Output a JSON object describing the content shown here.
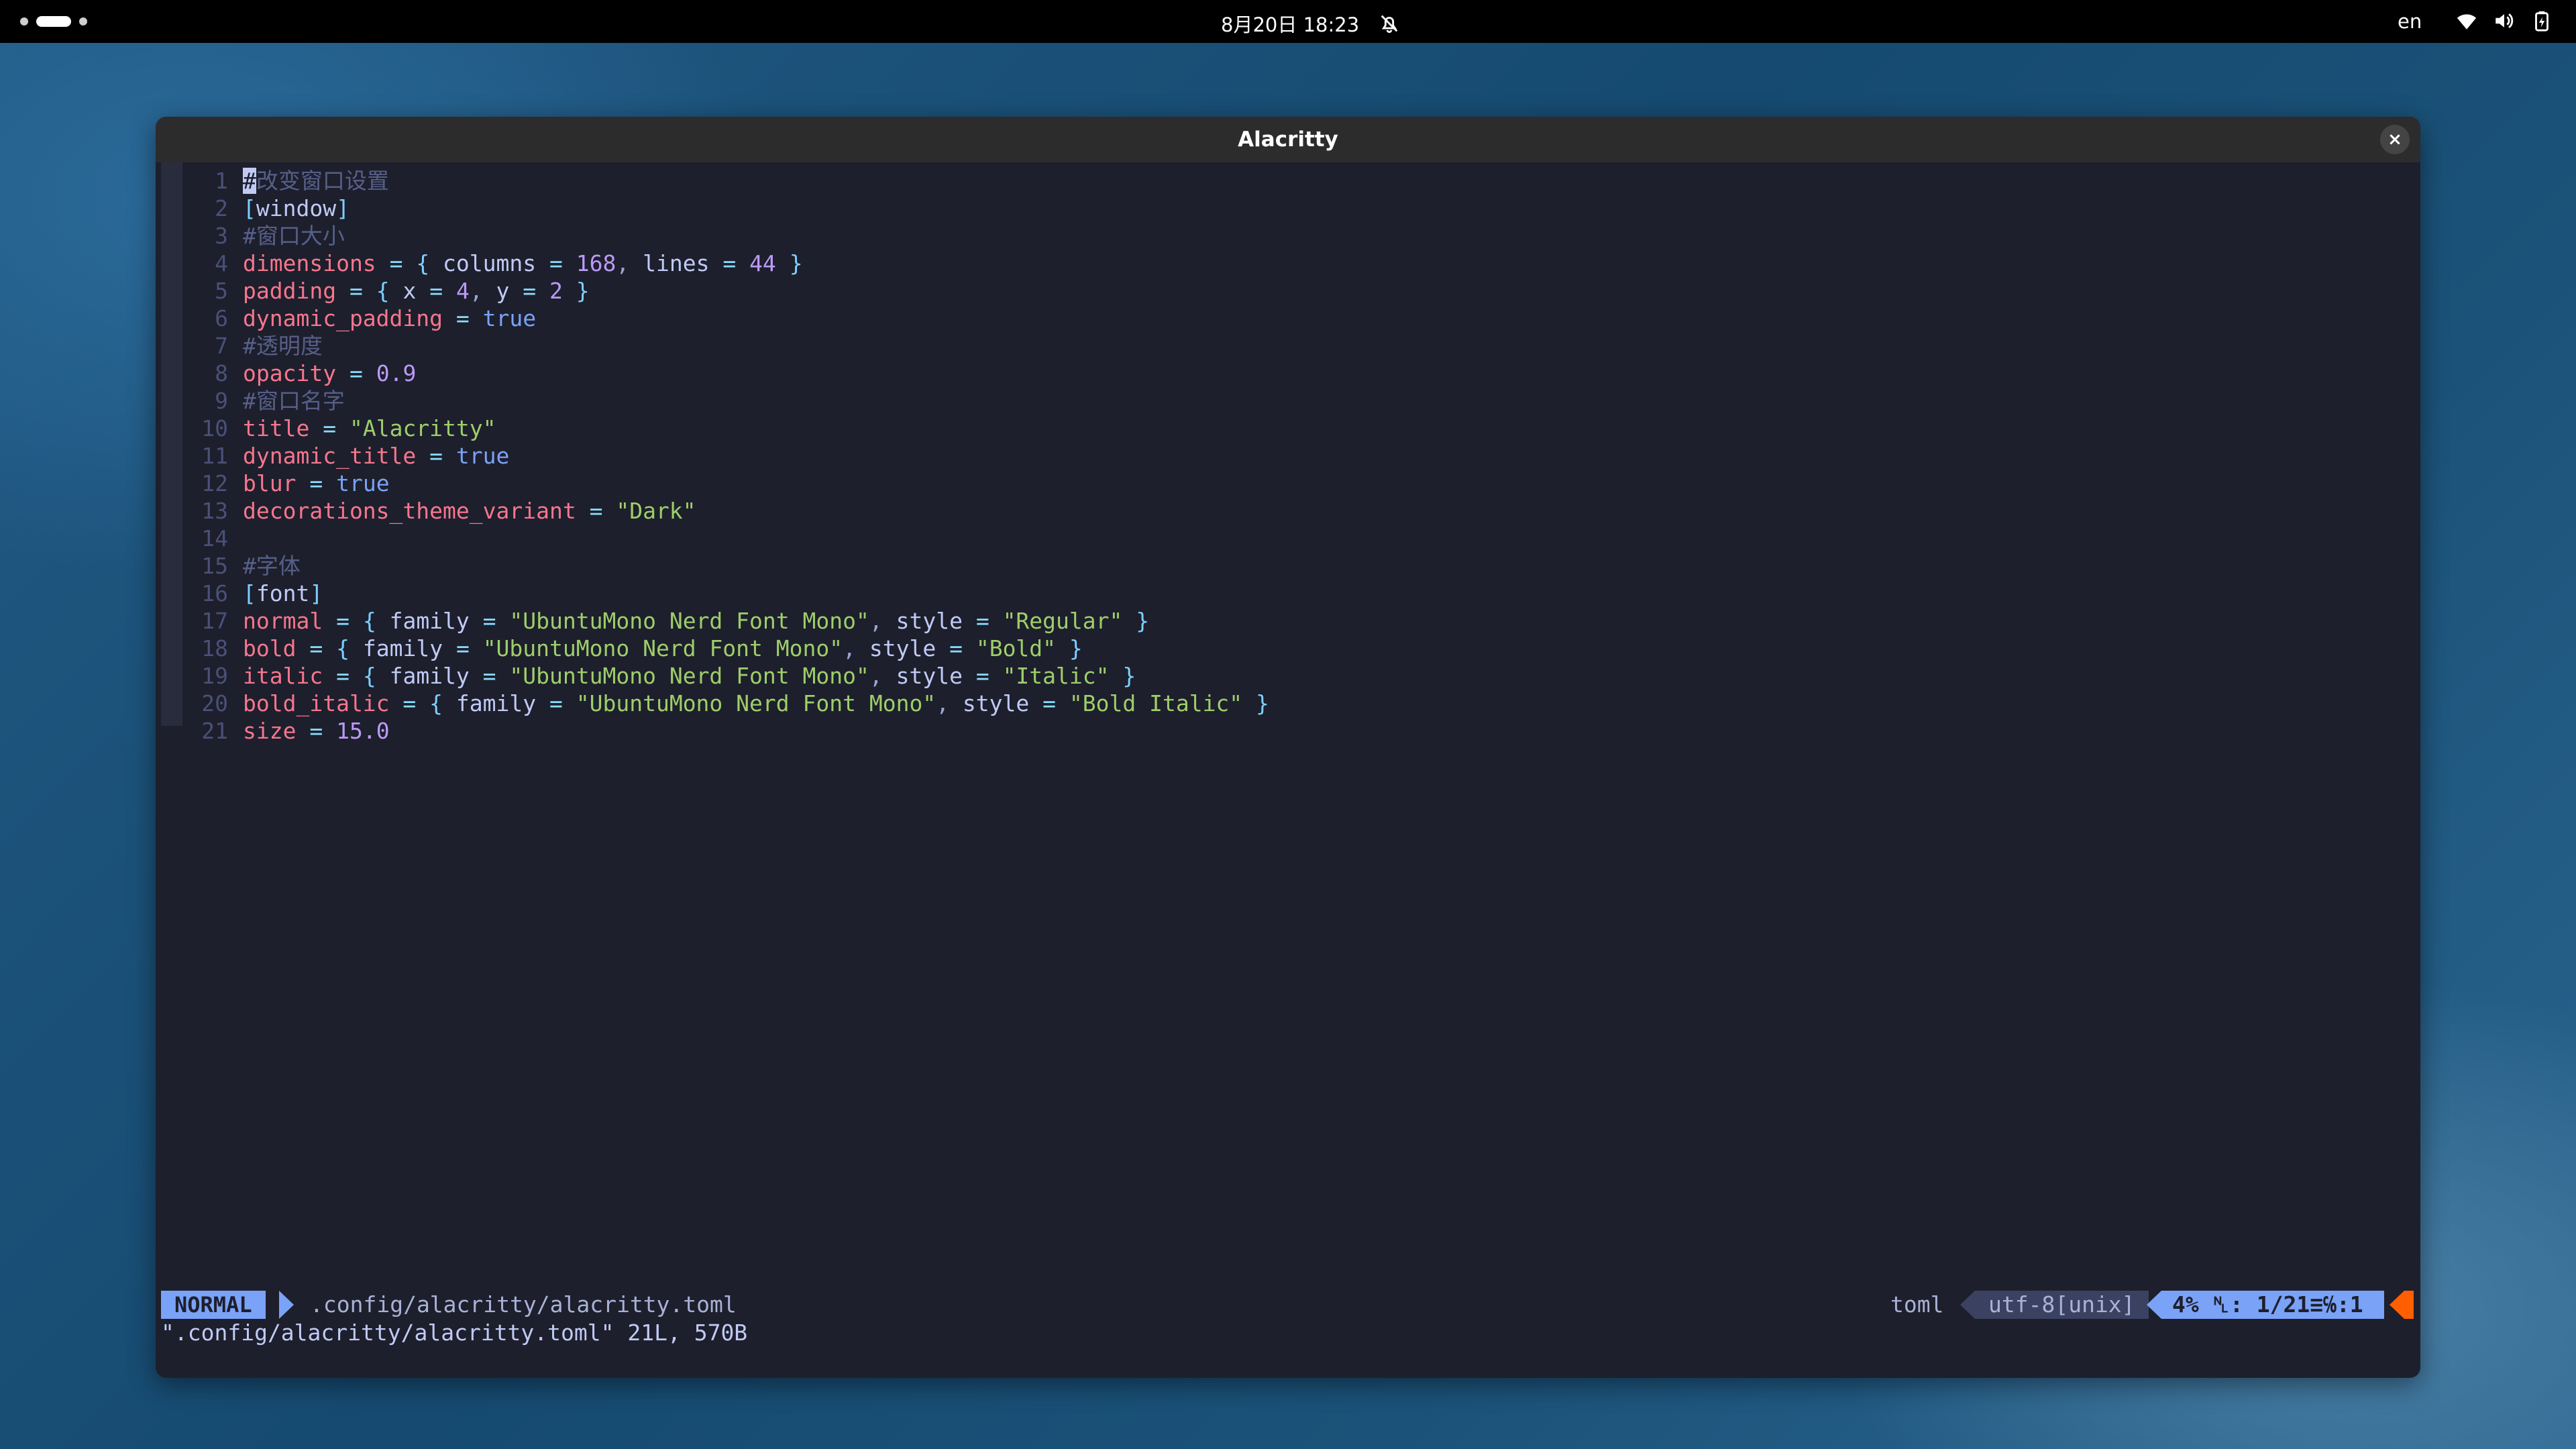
{
  "topbar": {
    "clock": "8月20日  18:23",
    "language": "en",
    "icons": [
      "workspace-indicator",
      "bell-off-icon",
      "wifi-icon",
      "volume-icon",
      "battery-icon"
    ]
  },
  "window": {
    "title": "Alacritty",
    "close_label": "×"
  },
  "editor": {
    "lines": [
      {
        "n": "1",
        "parts": [
          [
            "cursor",
            "#"
          ],
          [
            "cmt",
            "改变窗口设置"
          ]
        ]
      },
      {
        "n": "2",
        "parts": [
          [
            "brk",
            "["
          ],
          [
            "txt",
            "window"
          ],
          [
            "brk",
            "]"
          ]
        ]
      },
      {
        "n": "3",
        "parts": [
          [
            "cmt",
            "#窗口大小"
          ]
        ]
      },
      {
        "n": "4",
        "parts": [
          [
            "key",
            "dimensions"
          ],
          [
            "txt",
            " "
          ],
          [
            "op",
            "="
          ],
          [
            "txt",
            " "
          ],
          [
            "brk",
            "{"
          ],
          [
            "txt",
            " columns "
          ],
          [
            "op",
            "="
          ],
          [
            "txt",
            " "
          ],
          [
            "numv",
            "168"
          ],
          [
            "punc",
            ","
          ],
          [
            "txt",
            " lines "
          ],
          [
            "op",
            "="
          ],
          [
            "txt",
            " "
          ],
          [
            "numv",
            "44"
          ],
          [
            "txt",
            " "
          ],
          [
            "brk",
            "}"
          ]
        ]
      },
      {
        "n": "5",
        "parts": [
          [
            "key",
            "padding"
          ],
          [
            "txt",
            " "
          ],
          [
            "op",
            "="
          ],
          [
            "txt",
            " "
          ],
          [
            "brk",
            "{"
          ],
          [
            "txt",
            " x "
          ],
          [
            "op",
            "="
          ],
          [
            "txt",
            " "
          ],
          [
            "numv",
            "4"
          ],
          [
            "punc",
            ","
          ],
          [
            "txt",
            " y "
          ],
          [
            "op",
            "="
          ],
          [
            "txt",
            " "
          ],
          [
            "numv",
            "2"
          ],
          [
            "txt",
            " "
          ],
          [
            "brk",
            "}"
          ]
        ]
      },
      {
        "n": "6",
        "parts": [
          [
            "key",
            "dynamic_padding"
          ],
          [
            "txt",
            " "
          ],
          [
            "op",
            "="
          ],
          [
            "txt",
            " "
          ],
          [
            "bool",
            "true"
          ]
        ]
      },
      {
        "n": "7",
        "parts": [
          [
            "cmt",
            "#透明度"
          ]
        ]
      },
      {
        "n": "8",
        "parts": [
          [
            "key",
            "opacity"
          ],
          [
            "txt",
            " "
          ],
          [
            "op",
            "="
          ],
          [
            "txt",
            " "
          ],
          [
            "numv",
            "0.9"
          ]
        ]
      },
      {
        "n": "9",
        "parts": [
          [
            "cmt",
            "#窗口名字"
          ]
        ]
      },
      {
        "n": "10",
        "parts": [
          [
            "key",
            "title"
          ],
          [
            "txt",
            " "
          ],
          [
            "op",
            "="
          ],
          [
            "txt",
            " "
          ],
          [
            "str",
            "\"Alacritty\""
          ]
        ]
      },
      {
        "n": "11",
        "parts": [
          [
            "key",
            "dynamic_title"
          ],
          [
            "txt",
            " "
          ],
          [
            "op",
            "="
          ],
          [
            "txt",
            " "
          ],
          [
            "bool",
            "true"
          ]
        ]
      },
      {
        "n": "12",
        "parts": [
          [
            "key",
            "blur"
          ],
          [
            "txt",
            " "
          ],
          [
            "op",
            "="
          ],
          [
            "txt",
            " "
          ],
          [
            "bool",
            "true"
          ]
        ]
      },
      {
        "n": "13",
        "parts": [
          [
            "key",
            "decorations_theme_variant"
          ],
          [
            "txt",
            " "
          ],
          [
            "op",
            "="
          ],
          [
            "txt",
            " "
          ],
          [
            "str",
            "\"Dark\""
          ]
        ]
      },
      {
        "n": "14",
        "parts": []
      },
      {
        "n": "15",
        "parts": [
          [
            "cmt",
            "#字体"
          ]
        ]
      },
      {
        "n": "16",
        "parts": [
          [
            "brk",
            "["
          ],
          [
            "txt",
            "font"
          ],
          [
            "brk",
            "]"
          ]
        ]
      },
      {
        "n": "17",
        "parts": [
          [
            "key",
            "normal"
          ],
          [
            "txt",
            " "
          ],
          [
            "op",
            "="
          ],
          [
            "txt",
            " "
          ],
          [
            "brk",
            "{"
          ],
          [
            "txt",
            " family "
          ],
          [
            "op",
            "="
          ],
          [
            "txt",
            " "
          ],
          [
            "str",
            "\"UbuntuMono Nerd Font Mono\""
          ],
          [
            "punc",
            ","
          ],
          [
            "txt",
            " style "
          ],
          [
            "op",
            "="
          ],
          [
            "txt",
            " "
          ],
          [
            "str",
            "\"Regular\""
          ],
          [
            "txt",
            " "
          ],
          [
            "brk",
            "}"
          ]
        ]
      },
      {
        "n": "18",
        "parts": [
          [
            "key",
            "bold"
          ],
          [
            "txt",
            " "
          ],
          [
            "op",
            "="
          ],
          [
            "txt",
            " "
          ],
          [
            "brk",
            "{"
          ],
          [
            "txt",
            " family "
          ],
          [
            "op",
            "="
          ],
          [
            "txt",
            " "
          ],
          [
            "str",
            "\"UbuntuMono Nerd Font Mono\""
          ],
          [
            "punc",
            ","
          ],
          [
            "txt",
            " style "
          ],
          [
            "op",
            "="
          ],
          [
            "txt",
            " "
          ],
          [
            "str",
            "\"Bold\""
          ],
          [
            "txt",
            " "
          ],
          [
            "brk",
            "}"
          ]
        ]
      },
      {
        "n": "19",
        "parts": [
          [
            "key",
            "italic"
          ],
          [
            "txt",
            " "
          ],
          [
            "op",
            "="
          ],
          [
            "txt",
            " "
          ],
          [
            "brk",
            "{"
          ],
          [
            "txt",
            " family "
          ],
          [
            "op",
            "="
          ],
          [
            "txt",
            " "
          ],
          [
            "str",
            "\"UbuntuMono Nerd Font Mono\""
          ],
          [
            "punc",
            ","
          ],
          [
            "txt",
            " style "
          ],
          [
            "op",
            "="
          ],
          [
            "txt",
            " "
          ],
          [
            "str",
            "\"Italic\""
          ],
          [
            "txt",
            " "
          ],
          [
            "brk",
            "}"
          ]
        ]
      },
      {
        "n": "20",
        "parts": [
          [
            "key",
            "bold_italic"
          ],
          [
            "txt",
            " "
          ],
          [
            "op",
            "="
          ],
          [
            "txt",
            " "
          ],
          [
            "brk",
            "{"
          ],
          [
            "txt",
            " family "
          ],
          [
            "op",
            "="
          ],
          [
            "txt",
            " "
          ],
          [
            "str",
            "\"UbuntuMono Nerd Font Mono\""
          ],
          [
            "punc",
            ","
          ],
          [
            "txt",
            " style "
          ],
          [
            "op",
            "="
          ],
          [
            "txt",
            " "
          ],
          [
            "str",
            "\"Bold Italic\""
          ],
          [
            "txt",
            " "
          ],
          [
            "brk",
            "}"
          ]
        ]
      },
      {
        "n": "21",
        "parts": [
          [
            "key",
            "size"
          ],
          [
            "txt",
            " "
          ],
          [
            "op",
            "="
          ],
          [
            "txt",
            " "
          ],
          [
            "numv",
            "15.0"
          ]
        ]
      }
    ]
  },
  "statusline": {
    "mode": "NORMAL",
    "filename": ".config/alacritty/alacritty.toml",
    "filetype": "toml",
    "encoding": "utf-8[unix]",
    "position": "4% ␤: 1/21≡℅:1"
  },
  "message": "\".config/alacritty/alacritty.toml\" 21L, 570B",
  "colors": {
    "accent": "#7aa2f7",
    "comment": "#565f89",
    "key": "#f7768e",
    "string": "#9ece6a",
    "background": "#1d1f2c"
  }
}
